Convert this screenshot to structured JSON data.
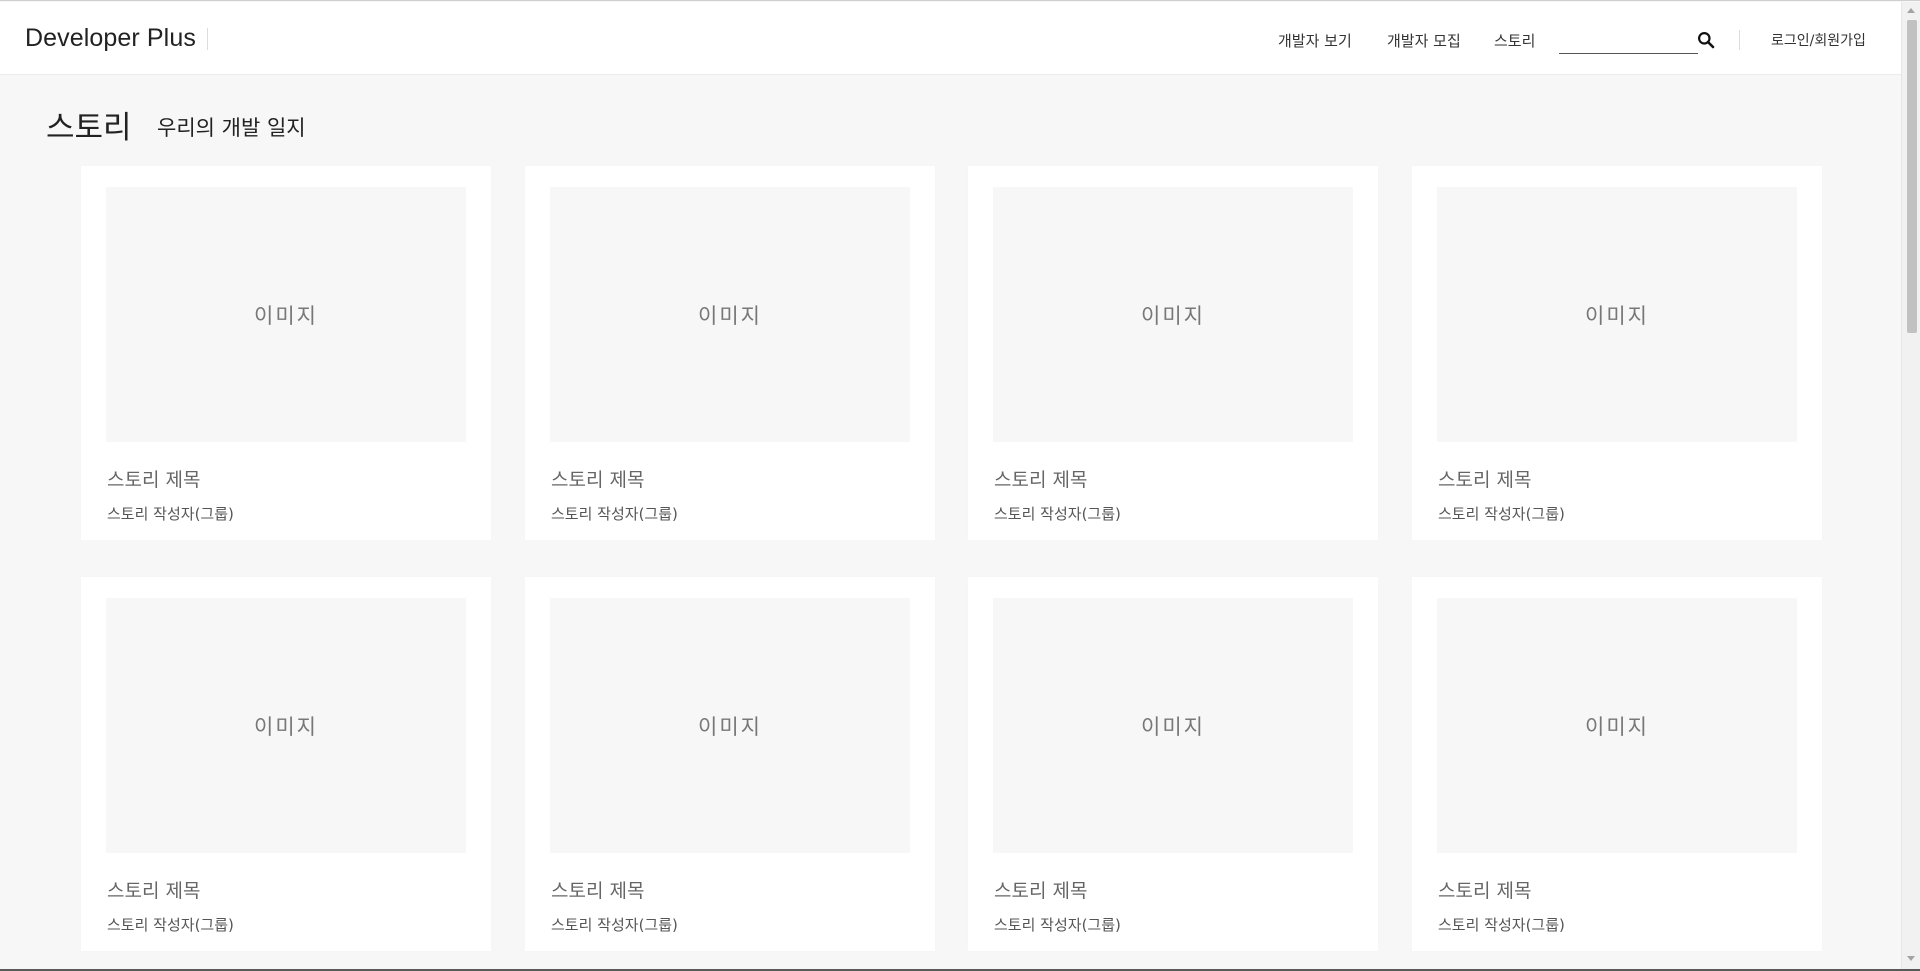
{
  "header": {
    "brand": "Developer Plus",
    "nav": {
      "view_developers": "개발자 보기",
      "recruit_developers": "개발자 모집",
      "story": "스토리"
    },
    "search": {
      "value": "",
      "placeholder": ""
    },
    "login": "로그인/회원가입"
  },
  "page": {
    "title": "스토리",
    "subtitle": "우리의 개발 일지"
  },
  "stories": [
    {
      "image_label": "이미지",
      "title": "스토리 제목",
      "author": "스토리 작성자(그룹)"
    },
    {
      "image_label": "이미지",
      "title": "스토리 제목",
      "author": "스토리 작성자(그룹)"
    },
    {
      "image_label": "이미지",
      "title": "스토리 제목",
      "author": "스토리 작성자(그룹)"
    },
    {
      "image_label": "이미지",
      "title": "스토리 제목",
      "author": "스토리 작성자(그룹)"
    },
    {
      "image_label": "이미지",
      "title": "스토리 제목",
      "author": "스토리 작성자(그룹)"
    },
    {
      "image_label": "이미지",
      "title": "스토리 제목",
      "author": "스토리 작성자(그룹)"
    },
    {
      "image_label": "이미지",
      "title": "스토리 제목",
      "author": "스토리 작성자(그룹)"
    },
    {
      "image_label": "이미지",
      "title": "스토리 제목",
      "author": "스토리 작성자(그룹)"
    }
  ],
  "icons": {
    "search": "search-icon"
  }
}
